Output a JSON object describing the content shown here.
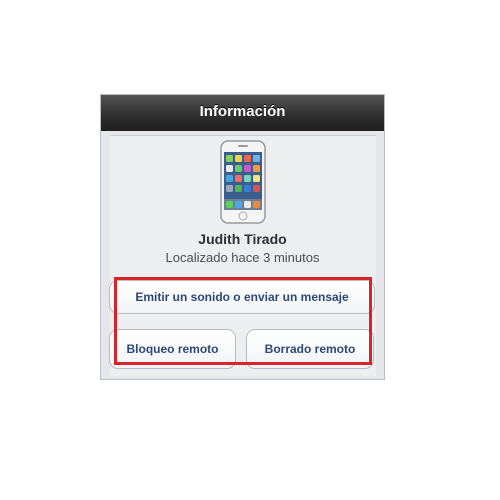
{
  "header": {
    "title": "Información"
  },
  "device": {
    "owner_name": "Judith Tirado",
    "status": "Localizado hace 3 minutos"
  },
  "actions": {
    "play_sound_label": "Emitir un sonido o enviar un mensaje",
    "remote_lock_label": "Bloqueo remoto",
    "remote_wipe_label": "Borrado remoto"
  },
  "colors": {
    "highlight": "#d8232a",
    "button_text": "#2e4876",
    "header_bg": "#2f2f2f"
  }
}
